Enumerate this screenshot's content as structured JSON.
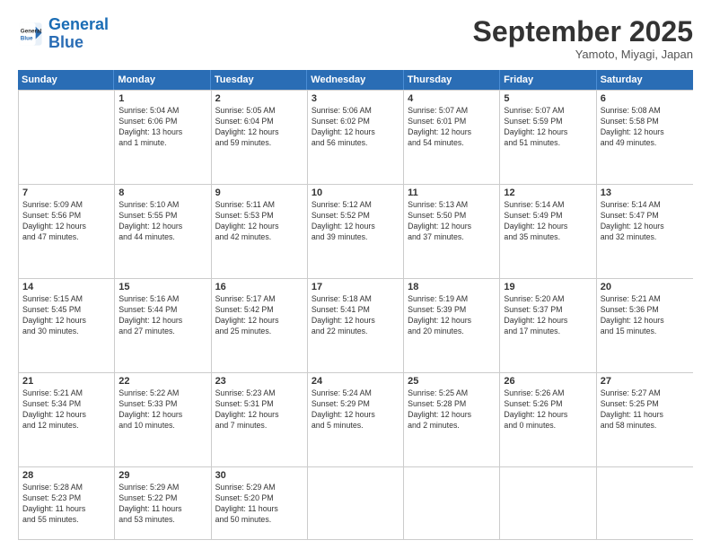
{
  "logo": {
    "line1": "General",
    "line2": "Blue"
  },
  "title": "September 2025",
  "location": "Yamoto, Miyagi, Japan",
  "weekdays": [
    "Sunday",
    "Monday",
    "Tuesday",
    "Wednesday",
    "Thursday",
    "Friday",
    "Saturday"
  ],
  "rows": [
    [
      {
        "day": "",
        "info": ""
      },
      {
        "day": "1",
        "info": "Sunrise: 5:04 AM\nSunset: 6:06 PM\nDaylight: 13 hours\nand 1 minute."
      },
      {
        "day": "2",
        "info": "Sunrise: 5:05 AM\nSunset: 6:04 PM\nDaylight: 12 hours\nand 59 minutes."
      },
      {
        "day": "3",
        "info": "Sunrise: 5:06 AM\nSunset: 6:02 PM\nDaylight: 12 hours\nand 56 minutes."
      },
      {
        "day": "4",
        "info": "Sunrise: 5:07 AM\nSunset: 6:01 PM\nDaylight: 12 hours\nand 54 minutes."
      },
      {
        "day": "5",
        "info": "Sunrise: 5:07 AM\nSunset: 5:59 PM\nDaylight: 12 hours\nand 51 minutes."
      },
      {
        "day": "6",
        "info": "Sunrise: 5:08 AM\nSunset: 5:58 PM\nDaylight: 12 hours\nand 49 minutes."
      }
    ],
    [
      {
        "day": "7",
        "info": "Sunrise: 5:09 AM\nSunset: 5:56 PM\nDaylight: 12 hours\nand 47 minutes."
      },
      {
        "day": "8",
        "info": "Sunrise: 5:10 AM\nSunset: 5:55 PM\nDaylight: 12 hours\nand 44 minutes."
      },
      {
        "day": "9",
        "info": "Sunrise: 5:11 AM\nSunset: 5:53 PM\nDaylight: 12 hours\nand 42 minutes."
      },
      {
        "day": "10",
        "info": "Sunrise: 5:12 AM\nSunset: 5:52 PM\nDaylight: 12 hours\nand 39 minutes."
      },
      {
        "day": "11",
        "info": "Sunrise: 5:13 AM\nSunset: 5:50 PM\nDaylight: 12 hours\nand 37 minutes."
      },
      {
        "day": "12",
        "info": "Sunrise: 5:14 AM\nSunset: 5:49 PM\nDaylight: 12 hours\nand 35 minutes."
      },
      {
        "day": "13",
        "info": "Sunrise: 5:14 AM\nSunset: 5:47 PM\nDaylight: 12 hours\nand 32 minutes."
      }
    ],
    [
      {
        "day": "14",
        "info": "Sunrise: 5:15 AM\nSunset: 5:45 PM\nDaylight: 12 hours\nand 30 minutes."
      },
      {
        "day": "15",
        "info": "Sunrise: 5:16 AM\nSunset: 5:44 PM\nDaylight: 12 hours\nand 27 minutes."
      },
      {
        "day": "16",
        "info": "Sunrise: 5:17 AM\nSunset: 5:42 PM\nDaylight: 12 hours\nand 25 minutes."
      },
      {
        "day": "17",
        "info": "Sunrise: 5:18 AM\nSunset: 5:41 PM\nDaylight: 12 hours\nand 22 minutes."
      },
      {
        "day": "18",
        "info": "Sunrise: 5:19 AM\nSunset: 5:39 PM\nDaylight: 12 hours\nand 20 minutes."
      },
      {
        "day": "19",
        "info": "Sunrise: 5:20 AM\nSunset: 5:37 PM\nDaylight: 12 hours\nand 17 minutes."
      },
      {
        "day": "20",
        "info": "Sunrise: 5:21 AM\nSunset: 5:36 PM\nDaylight: 12 hours\nand 15 minutes."
      }
    ],
    [
      {
        "day": "21",
        "info": "Sunrise: 5:21 AM\nSunset: 5:34 PM\nDaylight: 12 hours\nand 12 minutes."
      },
      {
        "day": "22",
        "info": "Sunrise: 5:22 AM\nSunset: 5:33 PM\nDaylight: 12 hours\nand 10 minutes."
      },
      {
        "day": "23",
        "info": "Sunrise: 5:23 AM\nSunset: 5:31 PM\nDaylight: 12 hours\nand 7 minutes."
      },
      {
        "day": "24",
        "info": "Sunrise: 5:24 AM\nSunset: 5:29 PM\nDaylight: 12 hours\nand 5 minutes."
      },
      {
        "day": "25",
        "info": "Sunrise: 5:25 AM\nSunset: 5:28 PM\nDaylight: 12 hours\nand 2 minutes."
      },
      {
        "day": "26",
        "info": "Sunrise: 5:26 AM\nSunset: 5:26 PM\nDaylight: 12 hours\nand 0 minutes."
      },
      {
        "day": "27",
        "info": "Sunrise: 5:27 AM\nSunset: 5:25 PM\nDaylight: 11 hours\nand 58 minutes."
      }
    ],
    [
      {
        "day": "28",
        "info": "Sunrise: 5:28 AM\nSunset: 5:23 PM\nDaylight: 11 hours\nand 55 minutes."
      },
      {
        "day": "29",
        "info": "Sunrise: 5:29 AM\nSunset: 5:22 PM\nDaylight: 11 hours\nand 53 minutes."
      },
      {
        "day": "30",
        "info": "Sunrise: 5:29 AM\nSunset: 5:20 PM\nDaylight: 11 hours\nand 50 minutes."
      },
      {
        "day": "",
        "info": ""
      },
      {
        "day": "",
        "info": ""
      },
      {
        "day": "",
        "info": ""
      },
      {
        "day": "",
        "info": ""
      }
    ]
  ]
}
